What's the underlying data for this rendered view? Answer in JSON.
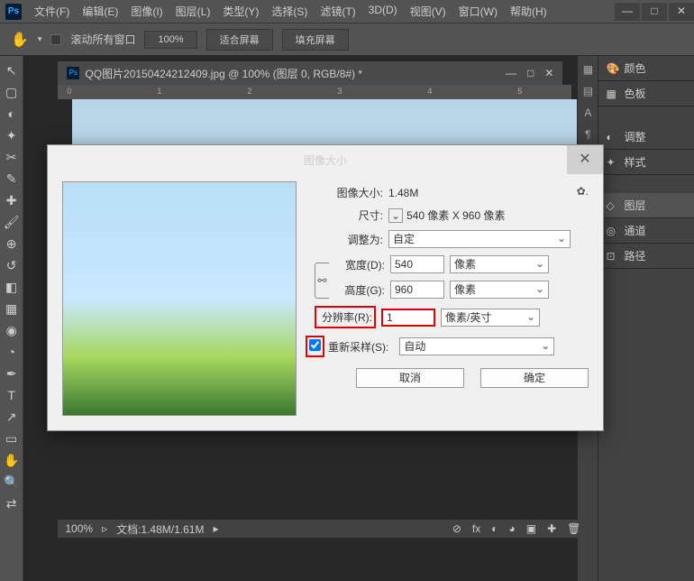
{
  "menu": {
    "file": "文件(F)",
    "edit": "编辑(E)",
    "image": "图像(I)",
    "layer": "图层(L)",
    "type": "类型(Y)",
    "select": "选择(S)",
    "filter": "滤镜(T)",
    "d3": "3D(D)",
    "view": "视图(V)",
    "window": "窗口(W)",
    "help": "帮助(H)"
  },
  "toolbar": {
    "scroll_all": "滚动所有窗口",
    "zoom": "100%",
    "fit": "适合屏幕",
    "fill": "填充屏幕"
  },
  "doc": {
    "title": "QQ图片20150424212409.jpg @ 100% (图层 0, RGB/8#) *"
  },
  "ruler": {
    "t0": "0",
    "t1": "1",
    "t2": "2",
    "t3": "3",
    "t4": "4",
    "t5": "5"
  },
  "status": {
    "zoom": "100%",
    "doc": "文档:1.48M/1.61M"
  },
  "panels": {
    "color": "颜色",
    "swatches": "色板",
    "adjust": "调整",
    "styles": "样式",
    "layers": "图层",
    "channels": "通道",
    "paths": "路径"
  },
  "dlg": {
    "title": "图像大小",
    "size_label": "图像大小:",
    "size_val": "1.48M",
    "dim_label": "尺寸:",
    "dim_val": "540 像素 X 960 像素",
    "fit_label": "调整为:",
    "fit_val": "自定",
    "w_label": "宽度(D):",
    "w_val": "540",
    "w_unit": "像素",
    "h_label": "高度(G):",
    "h_val": "960",
    "h_unit": "像素",
    "r_label": "分辨率(R):",
    "r_val": "1",
    "r_unit": "像素/英寸",
    "resample": "重新采样(S):",
    "resample_val": "自动",
    "cancel": "取消",
    "ok": "确定"
  }
}
